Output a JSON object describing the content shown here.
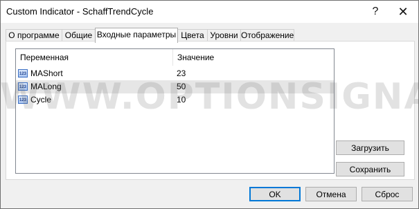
{
  "window": {
    "title": "Custom Indicator - SchaffTrendCycle",
    "help": "?",
    "close": "✕"
  },
  "tabs": [
    {
      "label": "О программе"
    },
    {
      "label": "Общие"
    },
    {
      "label": "Входные параметры"
    },
    {
      "label": "Цвета"
    },
    {
      "label": "Уровни"
    },
    {
      "label": "Отображение"
    }
  ],
  "params": {
    "header": {
      "variable": "Переменная",
      "value": "Значение"
    },
    "type_icon": "123",
    "rows": [
      {
        "name": "MAShort",
        "value": "23"
      },
      {
        "name": "MALong",
        "value": "50"
      },
      {
        "name": "Cycle",
        "value": "10"
      }
    ]
  },
  "side_buttons": {
    "load": "Загрузить",
    "save": "Сохранить"
  },
  "footer": {
    "ok": "OK",
    "cancel": "Отмена",
    "reset": "Сброс"
  },
  "watermark": "WWW.OPTIONSIGNALS.COM"
}
